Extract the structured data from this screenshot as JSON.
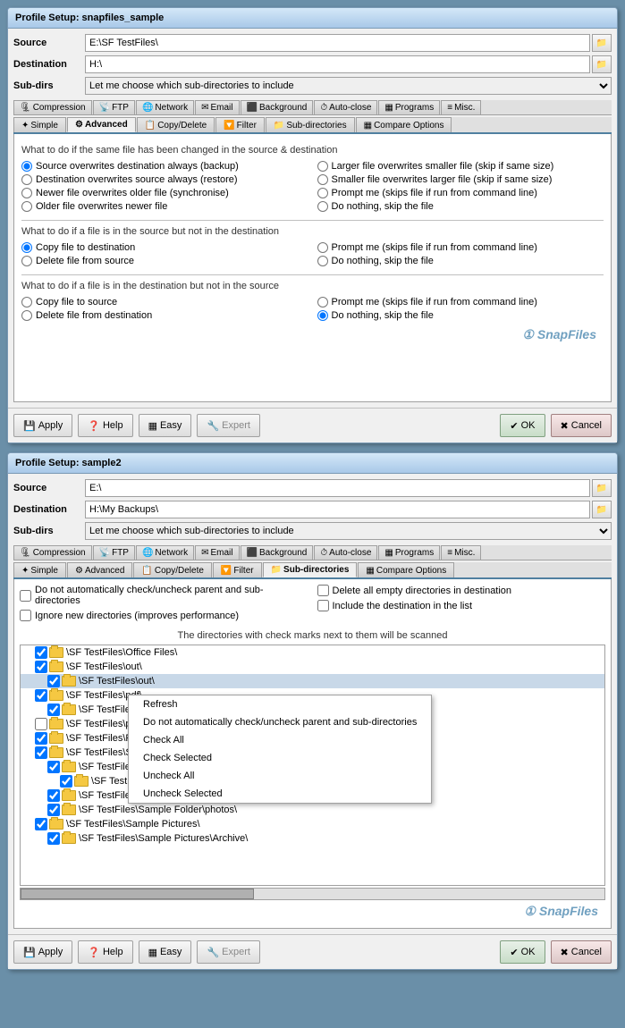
{
  "window1": {
    "title": "Profile Setup: snapfiles_sample",
    "source_label": "Source",
    "source_value": "E:\\SF TestFiles\\",
    "destination_label": "Destination",
    "destination_value": "H:\\",
    "subdirs_label": "Sub-dirs",
    "subdirs_value": "Let me choose which sub-directories to include",
    "tabs_row1": [
      {
        "label": "Compression",
        "icon": "compress"
      },
      {
        "label": "FTP",
        "icon": "ftp"
      },
      {
        "label": "Network",
        "icon": "network"
      },
      {
        "label": "Email",
        "icon": "email"
      },
      {
        "label": "Background",
        "icon": "background"
      },
      {
        "label": "Auto-close",
        "icon": "autoclose"
      },
      {
        "label": "Programs",
        "icon": "programs"
      },
      {
        "label": "Misc.",
        "icon": "misc"
      }
    ],
    "tabs_row2": [
      {
        "label": "Simple",
        "icon": "simple"
      },
      {
        "label": "Advanced",
        "icon": "advanced",
        "active": true
      },
      {
        "label": "Copy/Delete",
        "icon": "copy"
      },
      {
        "label": "Filter",
        "icon": "filter"
      },
      {
        "label": "Sub-directories",
        "icon": "subdirs"
      },
      {
        "label": "Compare Options",
        "icon": "compare"
      }
    ],
    "section1_label": "What to do if the same file has been changed in the source & destination",
    "section1_options_left": [
      "Source overwrites destination always (backup)",
      "Destination overwrites source always (restore)",
      "Newer file overwrites older file (synchronise)",
      "Older file overwrites newer file"
    ],
    "section1_options_right": [
      "Larger file overwrites smaller file (skip if same size)",
      "Smaller file overwrites larger file (skip if same size)",
      "Prompt me (skips file if run from command line)",
      "Do nothing, skip the file"
    ],
    "section1_selected": 0,
    "section2_label": "What to do if a file is in the source but not in the destination",
    "section2_options_left": [
      "Copy file to destination",
      "Delete file from source"
    ],
    "section2_options_right": [
      "Prompt me  (skips file if run from command line)",
      "Do nothing, skip the file"
    ],
    "section2_selected": 0,
    "section3_label": "What to do if a file is in the destination but not in the source",
    "section3_options_left": [
      "Copy file to source",
      "Delete file from destination"
    ],
    "section3_options_right": [
      "Prompt me  (skips file if run from command line)",
      "Do nothing, skip the file"
    ],
    "section3_selected_right": 1,
    "watermark": "SnapFiles",
    "btn_apply": "Apply",
    "btn_help": "Help",
    "btn_easy": "Easy",
    "btn_expert": "Expert",
    "btn_ok": "OK",
    "btn_cancel": "Cancel"
  },
  "window2": {
    "title": "Profile Setup: sample2",
    "source_label": "Source",
    "source_value": "E:\\",
    "destination_label": "Destination",
    "destination_value": "H:\\My Backups\\",
    "subdirs_label": "Sub-dirs",
    "subdirs_value": "Let me choose which sub-directories to include",
    "tabs_row1": [
      {
        "label": "Compression"
      },
      {
        "label": "FTP"
      },
      {
        "label": "Network"
      },
      {
        "label": "Email"
      },
      {
        "label": "Background"
      },
      {
        "label": "Auto-close"
      },
      {
        "label": "Programs"
      },
      {
        "label": "Misc."
      }
    ],
    "tabs_row2": [
      {
        "label": "Simple"
      },
      {
        "label": "Advanced"
      },
      {
        "label": "Copy/Delete"
      },
      {
        "label": "Filter"
      },
      {
        "label": "Sub-directories",
        "active": true
      },
      {
        "label": "Compare Options"
      }
    ],
    "check1": "Do not automatically check/uncheck parent and sub-directories",
    "check2": "Ignore new directories (improves performance)",
    "check3": "Delete all empty directories in destination",
    "check4": "Include the destination in the list",
    "dir_scan_label": "The directories with check marks next to them will be scanned",
    "tree_items": [
      {
        "indent": 0,
        "checked": true,
        "label": "\\SF TestFiles\\Office Files\\"
      },
      {
        "indent": 0,
        "checked": true,
        "label": "\\SF TestFiles\\out\\"
      },
      {
        "indent": 1,
        "checked": true,
        "label": "\\SF TestFiles\\out\\",
        "selected": true
      },
      {
        "indent": 0,
        "checked": true,
        "label": "\\SF TestFiles\\pdf\\"
      },
      {
        "indent": 1,
        "checked": true,
        "label": "\\SF TestFiles\\pdf\\out"
      },
      {
        "indent": 0,
        "checked": false,
        "label": "\\SF TestFiles\\php scripts"
      },
      {
        "indent": 0,
        "checked": true,
        "label": "\\SF TestFiles\\RAR\\"
      },
      {
        "indent": 0,
        "checked": true,
        "label": "\\SF TestFiles\\Sample Fold..."
      },
      {
        "indent": 1,
        "checked": true,
        "label": "\\SF TestFiles\\Sample ..."
      },
      {
        "indent": 2,
        "checked": true,
        "label": "\\SF TestFiles\\Samp..."
      },
      {
        "indent": 1,
        "checked": true,
        "label": "\\SF TestFiles\\Sample Folder\\..."
      },
      {
        "indent": 1,
        "checked": true,
        "label": "\\SF TestFiles\\Sample Folder\\photos\\"
      },
      {
        "indent": 0,
        "checked": true,
        "label": "\\SF TestFiles\\Sample Pictures\\"
      },
      {
        "indent": 1,
        "checked": true,
        "label": "\\SF TestFiles\\Sample Pictures\\Archive\\"
      }
    ],
    "context_menu": [
      {
        "label": "Refresh"
      },
      {
        "label": "Do not automatically check/uncheck parent and sub-directories"
      },
      {
        "label": "Check All"
      },
      {
        "label": "Check Selected"
      },
      {
        "label": "Uncheck All"
      },
      {
        "label": "Uncheck Selected"
      }
    ],
    "btn_apply": "Apply",
    "btn_help": "Help",
    "btn_easy": "Easy",
    "btn_expert": "Expert",
    "btn_ok": "OK",
    "btn_cancel": "Cancel"
  }
}
